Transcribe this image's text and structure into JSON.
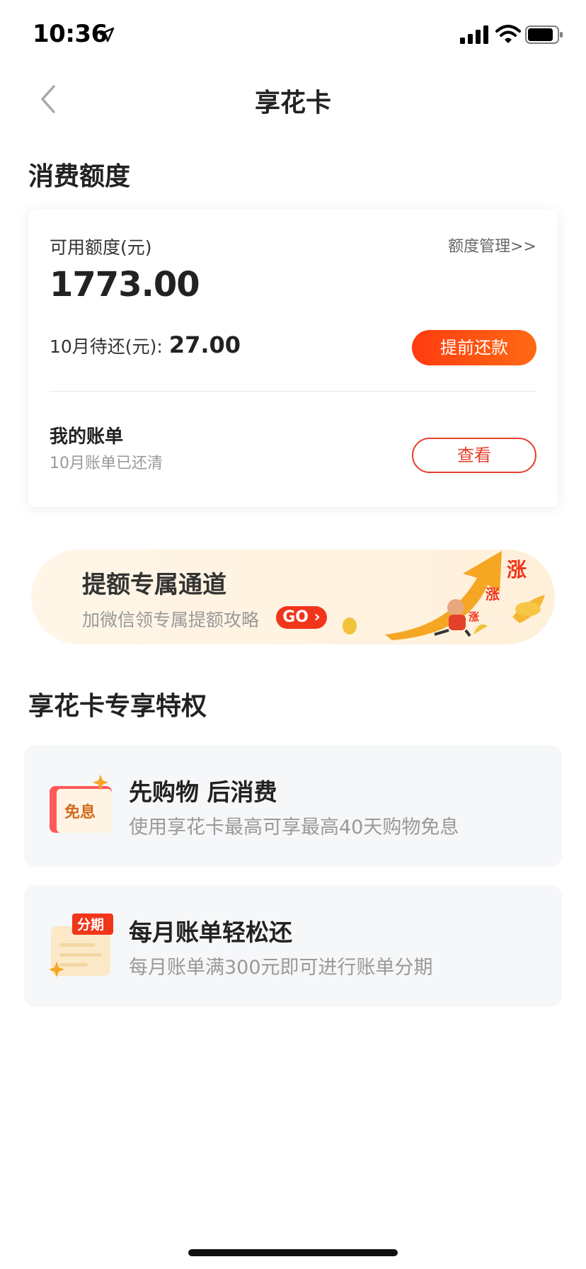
{
  "status_bar": {
    "time": "10:36"
  },
  "nav": {
    "title": "享花卡"
  },
  "quota_section": {
    "title": "消费额度",
    "available_label": "可用额度(元)",
    "manage_link": "额度管理>>",
    "available_amount": "1773.00",
    "due_label": "10月待还(元):",
    "due_amount": "27.00",
    "repay_button": "提前还款",
    "bill_title": "我的账单",
    "bill_status": "10月账单已还清",
    "view_button": "查看"
  },
  "banner": {
    "title": "提额专属通道",
    "subtitle": "加微信领专属提额攻略",
    "go_label": "GO",
    "art_text": "涨"
  },
  "privileges": {
    "title": "享花卡专享特权",
    "items": [
      {
        "title": "先购物 后消费",
        "desc": "使用享花卡最高可享最高40天购物免息",
        "icon_label": "免息"
      },
      {
        "title": "每月账单轻松还",
        "desc": "每月账单满300元即可进行账单分期",
        "icon_label": "分期"
      }
    ]
  },
  "colors": {
    "accent": "#f1351a",
    "accent_gradient_end": "#ff6a14",
    "card_bg": "#f6f7f9"
  }
}
